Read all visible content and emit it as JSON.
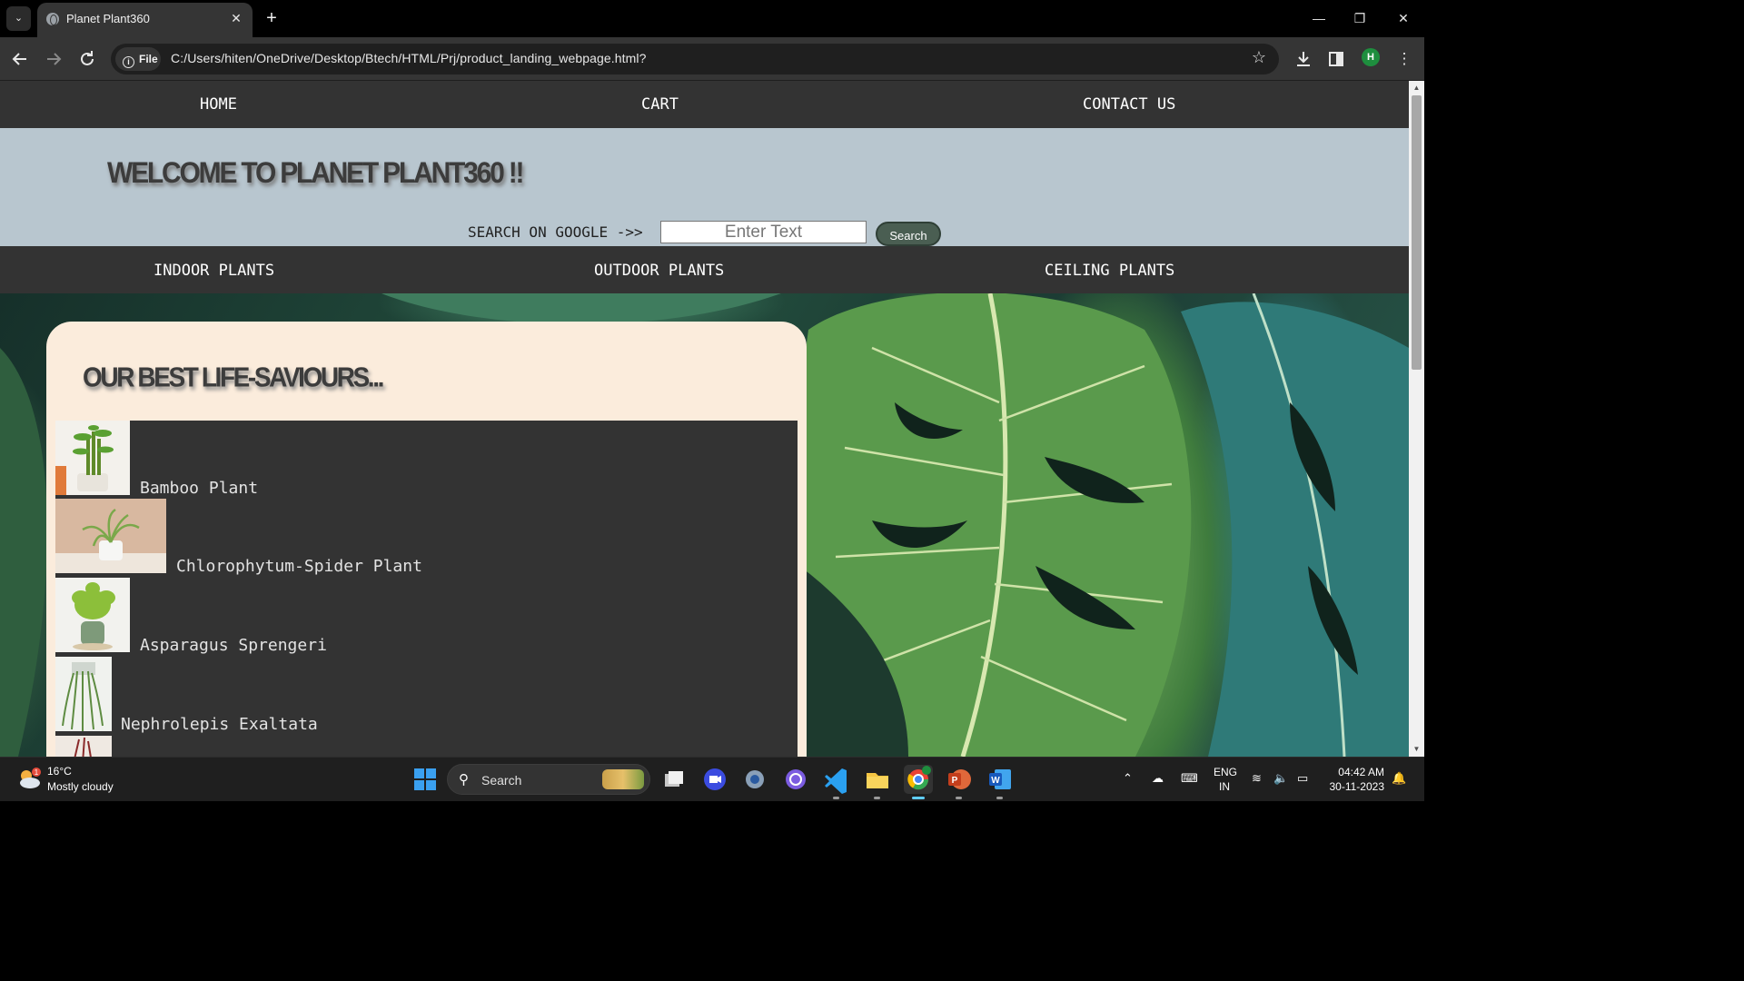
{
  "browser": {
    "tab_title": "Planet Plant360",
    "tab_close": "✕",
    "new_tab": "+",
    "url_chip": "File",
    "url": "C:/Users/hiten/OneDrive/Desktop/Btech/HTML/Prj/product_landing_webpage.html?",
    "profile_initial": "H",
    "window_buttons": {
      "minimize": "—",
      "restore": "❐",
      "close": "✕"
    }
  },
  "nav": {
    "home": "HOME",
    "cart": "CART",
    "contact": "CONTACT US"
  },
  "banner": {
    "welcome": "WELCOME TO PLANET PLANT360 !!",
    "search_label": "SEARCH ON GOOGLE ->>",
    "search_placeholder": "Enter Text",
    "search_button": "Search"
  },
  "categories": {
    "indoor": "INDOOR PLANTS",
    "outdoor": "OUTDOOR PLANTS",
    "ceiling": "CEILING PLANTS"
  },
  "card": {
    "title": "OUR BEST LIFE-SAVIOURS..."
  },
  "plants": [
    {
      "name": "Bamboo Plant",
      "icon": "bamboo-plant-photo"
    },
    {
      "name": "Chlorophytum-Spider Plant",
      "icon": "spider-plant-photo"
    },
    {
      "name": "Asparagus Sprengeri",
      "icon": "asparagus-plant-photo"
    },
    {
      "name": "Nephrolepis Exaltata",
      "icon": "fern-plant-photo"
    }
  ],
  "taskbar": {
    "weather_temp": "16°C",
    "weather_desc": "Mostly cloudy",
    "weather_badge": "1",
    "search_text": "Search",
    "lang_top": "ENG",
    "lang_bottom": "IN",
    "time": "04:42 AM",
    "date": "30-11-2023"
  },
  "colors": {
    "nav_bg": "#333333",
    "banner_bg": "#b8c6cf",
    "card_bg": "#fbecdc",
    "search_button_bg": "#4a5e52"
  }
}
